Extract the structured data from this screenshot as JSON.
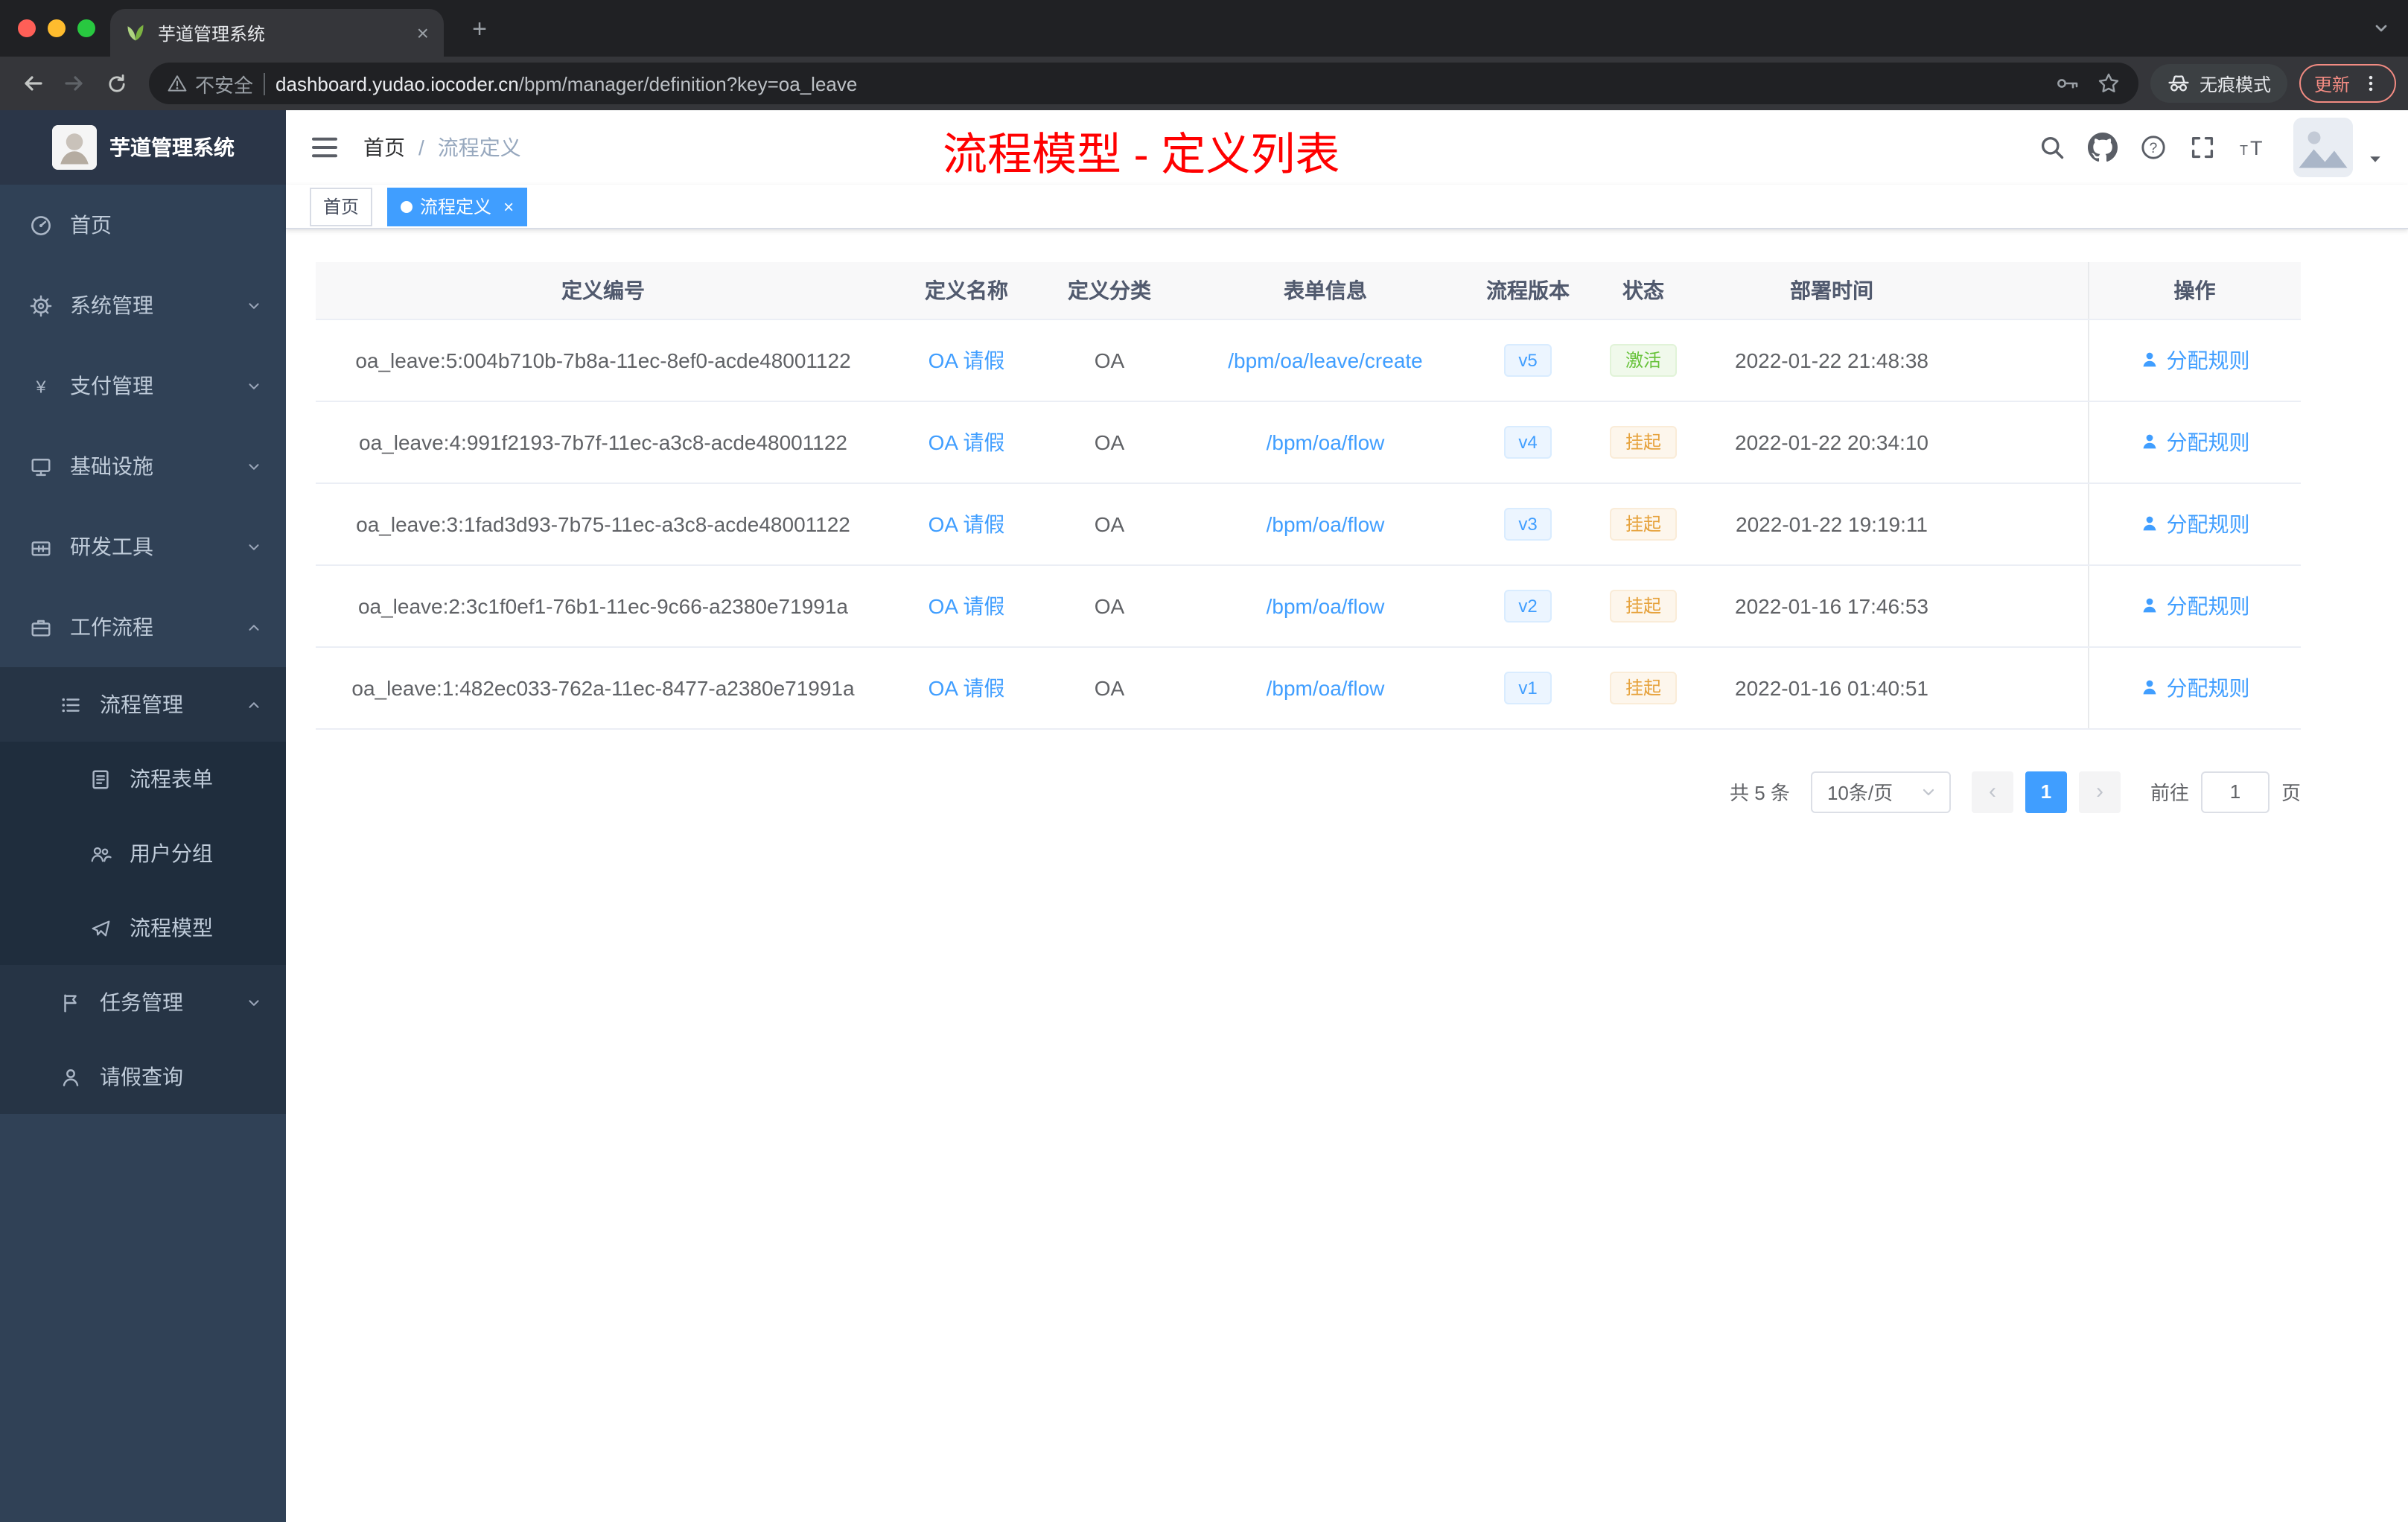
{
  "browser": {
    "tab_title": "芋道管理系统",
    "security_chip": "不安全",
    "url_domain": "dashboard.yudao.iocoder.cn",
    "url_path": "/bpm/manager/definition?key=oa_leave",
    "incognito_label": "无痕模式",
    "update_label": "更新"
  },
  "sidebar": {
    "logo_title": "芋道管理系统",
    "items": [
      {
        "label": "首页",
        "icon": "dashboard-icon",
        "level": 1
      },
      {
        "label": "系统管理",
        "icon": "gear-icon",
        "level": 1,
        "chevron": "down"
      },
      {
        "label": "支付管理",
        "icon": "yen-icon",
        "level": 1,
        "chevron": "down"
      },
      {
        "label": "基础设施",
        "icon": "infrastructure-icon",
        "level": 1,
        "chevron": "down"
      },
      {
        "label": "研发工具",
        "icon": "dev-tools-icon",
        "level": 1,
        "chevron": "down"
      },
      {
        "label": "工作流程",
        "icon": "workflow-icon",
        "level": 1,
        "chevron": "up"
      },
      {
        "label": "流程管理",
        "icon": "process-list-icon",
        "level": 2,
        "chevron": "up"
      },
      {
        "label": "流程表单",
        "icon": "form-icon",
        "level": 3
      },
      {
        "label": "用户分组",
        "icon": "user-group-icon",
        "level": 3
      },
      {
        "label": "流程模型",
        "icon": "paper-plane-icon",
        "level": 3
      },
      {
        "label": "任务管理",
        "icon": "task-icon",
        "level": 2,
        "chevron": "down"
      },
      {
        "label": "请假查询",
        "icon": "person-icon",
        "level": 2
      }
    ]
  },
  "header": {
    "breadcrumb": [
      "首页",
      "流程定义"
    ],
    "breadcrumb_separator": "/",
    "annotation": "流程模型 - 定义列表",
    "annotation_color": "#ff0000"
  },
  "tags_view": [
    {
      "label": "首页",
      "active": false
    },
    {
      "label": "流程定义",
      "active": true
    }
  ],
  "table": {
    "columns": [
      "定义编号",
      "定义名称",
      "定义分类",
      "表单信息",
      "流程版本",
      "状态",
      "部署时间",
      "操作"
    ],
    "rows": [
      {
        "id": "oa_leave:5:004b710b-7b8a-11ec-8ef0-acde48001122",
        "name": "OA 请假",
        "category": "OA",
        "form": "/bpm/oa/leave/create",
        "version": "v5",
        "status": "激活",
        "status_type": "success",
        "deploy_time": "2022-01-22 21:48:38",
        "action": "分配规则"
      },
      {
        "id": "oa_leave:4:991f2193-7b7f-11ec-a3c8-acde48001122",
        "name": "OA 请假",
        "category": "OA",
        "form": "/bpm/oa/flow",
        "version": "v4",
        "status": "挂起",
        "status_type": "warning",
        "deploy_time": "2022-01-22 20:34:10",
        "action": "分配规则"
      },
      {
        "id": "oa_leave:3:1fad3d93-7b75-11ec-a3c8-acde48001122",
        "name": "OA 请假",
        "category": "OA",
        "form": "/bpm/oa/flow",
        "version": "v3",
        "status": "挂起",
        "status_type": "warning",
        "deploy_time": "2022-01-22 19:19:11",
        "action": "分配规则"
      },
      {
        "id": "oa_leave:2:3c1f0ef1-76b1-11ec-9c66-a2380e71991a",
        "name": "OA 请假",
        "category": "OA",
        "form": "/bpm/oa/flow",
        "version": "v2",
        "status": "挂起",
        "status_type": "warning",
        "deploy_time": "2022-01-16 17:46:53",
        "action": "分配规则"
      },
      {
        "id": "oa_leave:1:482ec033-762a-11ec-8477-a2380e71991a",
        "name": "OA 请假",
        "category": "OA",
        "form": "/bpm/oa/flow",
        "version": "v1",
        "status": "挂起",
        "status_type": "warning",
        "deploy_time": "2022-01-16 01:40:51",
        "action": "分配规则"
      }
    ]
  },
  "pagination": {
    "total": "共 5 条",
    "page_size": "10条/页",
    "current_page": "1",
    "goto_label": "前往",
    "goto_value": "1",
    "page_label": "页"
  },
  "colors": {
    "primary": "#409eff",
    "success": "#67c23a",
    "warning": "#e6a23c",
    "sidebar_bg": "#304156",
    "annotation": "#ff0000"
  }
}
